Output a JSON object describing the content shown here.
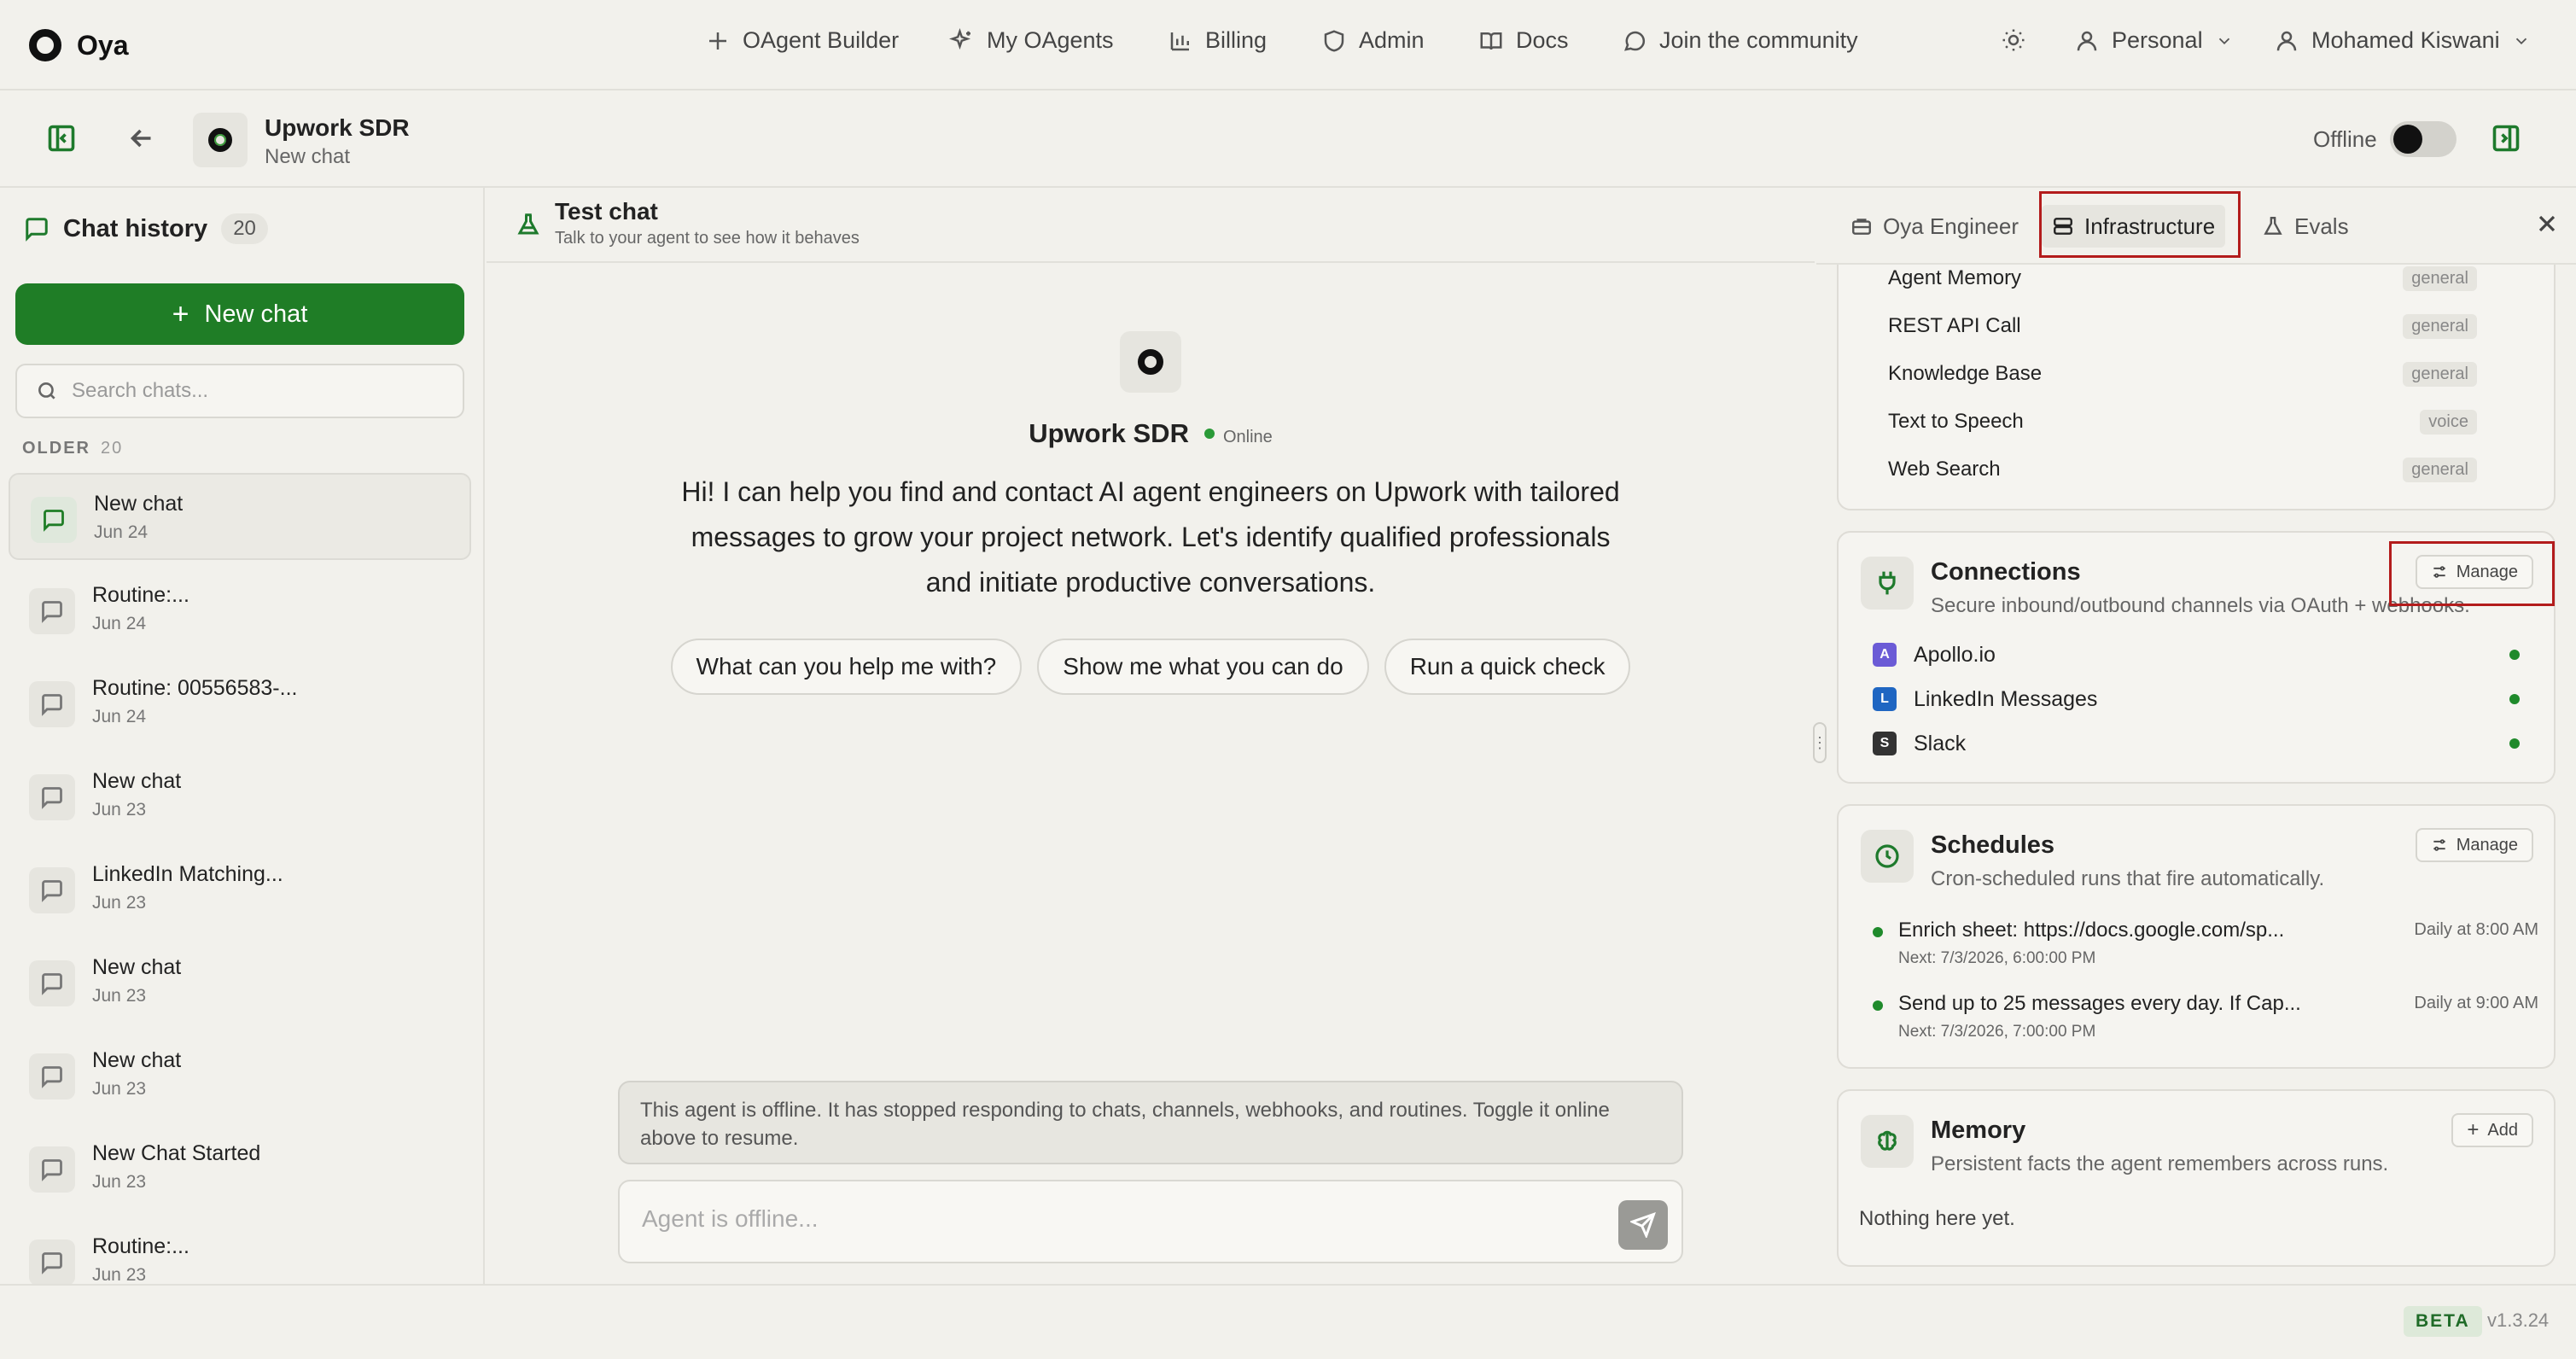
{
  "app": {
    "name": "Oya"
  },
  "topnav": {
    "items": [
      {
        "label": "OAgent Builder",
        "icon": "plus-icon"
      },
      {
        "label": "My OAgents",
        "icon": "sparkles-icon"
      },
      {
        "label": "Billing",
        "icon": "bar-chart-icon"
      },
      {
        "label": "Admin",
        "icon": "shield-icon"
      },
      {
        "label": "Docs",
        "icon": "book-icon"
      },
      {
        "label": "Join the community",
        "icon": "chat-bubble-icon"
      }
    ],
    "workspace": "Personal",
    "user": "Mohamed Kiswani"
  },
  "header": {
    "agent_name": "Upwork SDR",
    "chat_name": "New chat",
    "status_label": "Offline",
    "online": false
  },
  "sidebar": {
    "title": "Chat history",
    "count": "20",
    "new_chat_label": "New chat",
    "search_placeholder": "Search chats...",
    "section_label": "OLDER",
    "section_count": "20",
    "chats": [
      {
        "title": "New chat",
        "date": "Jun 24"
      },
      {
        "title": "Routine:...",
        "date": "Jun 24"
      },
      {
        "title": "Routine: 00556583-...",
        "date": "Jun 24"
      },
      {
        "title": "New chat",
        "date": "Jun 23"
      },
      {
        "title": "LinkedIn Matching...",
        "date": "Jun 23"
      },
      {
        "title": "New chat",
        "date": "Jun 23"
      },
      {
        "title": "New chat",
        "date": "Jun 23"
      },
      {
        "title": "New Chat Started",
        "date": "Jun 23"
      },
      {
        "title": "Routine:...",
        "date": "Jun 23"
      }
    ]
  },
  "testchat": {
    "title": "Test chat",
    "subtitle": "Talk to your agent to see how it behaves",
    "agent_name": "Upwork SDR",
    "agent_status": "Online",
    "welcome": "Hi! I can help you find and contact AI agent engineers on Upwork with tailored messages to grow your project network. Let's identify qualified professionals and initiate productive conversations.",
    "suggestions": [
      "What can you help me with?",
      "Show me what you can do",
      "Run a quick check"
    ],
    "offline_note": "This agent is offline. It has stopped responding to chats, channels, webhooks, and routines. Toggle it online above to resume.",
    "input_placeholder": "Agent is offline..."
  },
  "rightpanel": {
    "tabs": [
      {
        "label": "Oya Engineer",
        "icon": "briefcase-icon"
      },
      {
        "label": "Infrastructure",
        "icon": "server-icon"
      },
      {
        "label": "Evals",
        "icon": "flask-icon"
      }
    ],
    "active_tab": "Infrastructure",
    "tools": [
      {
        "name": "Agent Memory",
        "tag": "general"
      },
      {
        "name": "REST API Call",
        "tag": "general"
      },
      {
        "name": "Knowledge Base",
        "tag": "general"
      },
      {
        "name": "Text to Speech",
        "tag": "voice"
      },
      {
        "name": "Web Search",
        "tag": "general"
      }
    ],
    "connections": {
      "title": "Connections",
      "subtitle": "Secure inbound/outbound channels via OAuth + webhooks.",
      "manage_label": "Manage",
      "items": [
        {
          "name": "Apollo.io",
          "letter": "A",
          "color": "#6b5bd6"
        },
        {
          "name": "LinkedIn Messages",
          "letter": "L",
          "color": "#1f66c2"
        },
        {
          "name": "Slack",
          "letter": "S",
          "color": "#333333"
        }
      ]
    },
    "schedules": {
      "title": "Schedules",
      "subtitle": "Cron-scheduled runs that fire automatically.",
      "manage_label": "Manage",
      "items": [
        {
          "name": "Enrich sheet: https://docs.google.com/sp...",
          "next": "Next: 7/3/2026, 6:00:00 PM",
          "when": "Daily at 8:00 AM"
        },
        {
          "name": "Send up to 25 messages every day. If Cap...",
          "next": "Next: 7/3/2026, 7:00:00 PM",
          "when": "Daily at 9:00 AM"
        }
      ]
    },
    "memory": {
      "title": "Memory",
      "subtitle": "Persistent facts the agent remembers across runs.",
      "add_label": "Add",
      "empty": "Nothing here yet."
    }
  },
  "footer": {
    "beta": "BETA",
    "version": "v1.3.24"
  },
  "colors": {
    "accent": "#1f7d26",
    "status_online": "#2a9a37",
    "highlight": "#b31c1c"
  }
}
